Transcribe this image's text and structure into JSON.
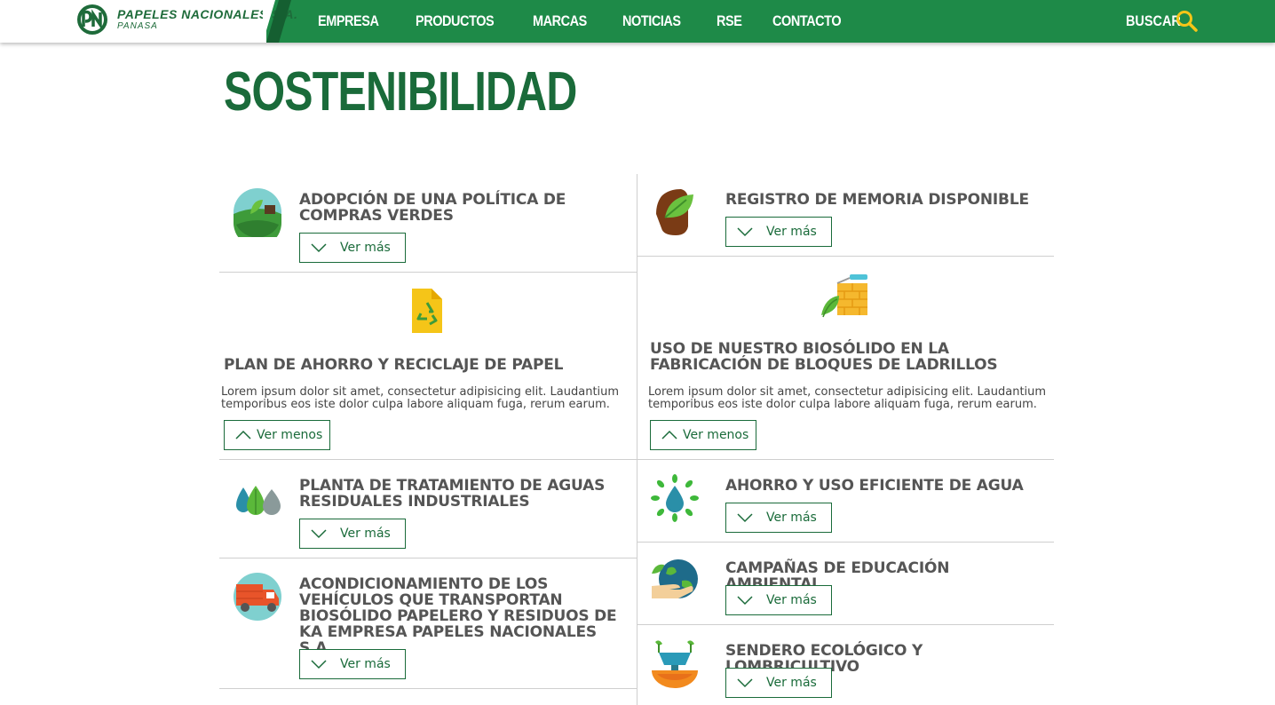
{
  "header": {
    "logo_title": "PAPELES NACIONALES S.A.",
    "logo_sub": "PANASA",
    "nav": [
      "EMPRESA",
      "PRODUCTOS",
      "MARCAS",
      "NOTICIAS",
      "RSE",
      "CONTACTO"
    ],
    "search_label": "BUSCAR"
  },
  "page_title": "SOSTENIBILIDAD",
  "colors": {
    "brand_green": "#1e8a48",
    "title_green": "#1a6b3a",
    "search_yellow": "#f5c518"
  },
  "cards": {
    "c1": {
      "title": "ADOPCIÓN DE UNA POLÍTICA DE COMPRAS VERDES",
      "button": "Ver más",
      "icon": "farm-leaf-icon"
    },
    "c2": {
      "title": "REGISTRO DE MEMORIA DISPONIBLE",
      "button": "Ver más",
      "icon": "leaf-tree-icon"
    },
    "c3": {
      "title": "PLAN DE AHORRO Y RECICLAJE DE PAPEL",
      "text": "Lorem ipsum dolor sit amet, consectetur adipisicing elit. Laudantium temporibus eos iste dolor culpa labore aliquam fuga, rerum earum.",
      "button": "Ver menos",
      "icon": "recycle-document-icon"
    },
    "c4": {
      "title": "USO DE NUESTRO BIOSÓLIDO EN LA FABRICACIÓN DE BLOQUES DE LADRILLOS",
      "text": "Lorem ipsum dolor sit amet, consectetur adipisicing elit. Laudantium temporibus eos iste dolor culpa labore aliquam fuga, rerum earum.",
      "button": "Ver menos",
      "icon": "brick-wall-icon"
    },
    "c5": {
      "title": "PLANTA DE TRATAMIENTO DE AGUAS RESIDUALES INDUSTRIALES",
      "button": "Ver más",
      "icon": "water-drops-icon"
    },
    "c6": {
      "title": "AHORRO Y USO EFICIENTE DE AGUA",
      "button": "Ver más",
      "icon": "water-drop-leaves-icon"
    },
    "c7": {
      "title": "ACONDICIONAMIENTO DE LOS VEHÍCULOS QUE TRANSPORTAN BIOSÓLIDO PAPELERO Y RESIDUOS DE KA EMPRESA PAPELES NACIONALES S.A.",
      "button": "Ver más",
      "icon": "truck-globe-icon"
    },
    "c8": {
      "title": "CAMPAÑAS DE EDUCACIÓN AMBIENTAL",
      "button": "Ver más",
      "icon": "hand-globe-icon"
    },
    "c9": {
      "title": "SENDERO ECOLÓGICO Y LOMBRICULTIVO",
      "button": "Ver más",
      "icon": "soil-lamp-icon"
    }
  }
}
